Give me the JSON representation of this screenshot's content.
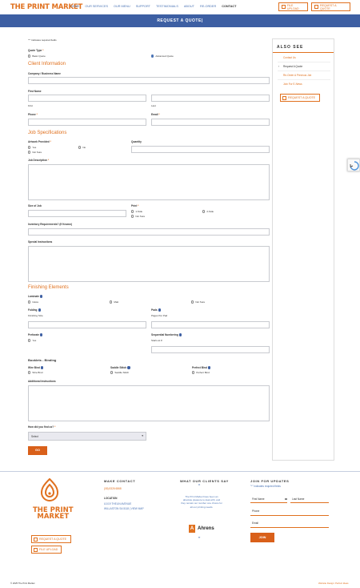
{
  "header": {
    "logo": "THE PRINT MARKET",
    "nav": [
      "HOME",
      "OUR SERVICES",
      "OUR MENU",
      "SUPPORT",
      "TESTIMONIALS",
      "ABOUT",
      "RE-ORDER",
      "CONTACT"
    ],
    "btn_upload": "FILE UPLOAD",
    "btn_quote": "REQUEST A QUOTE"
  },
  "banner": "REQUEST A QUOTE|",
  "form": {
    "required_note": "\"*\" indicates required fields",
    "quote_type_label": "Quote Type",
    "quote_type_options": [
      "Basic Quote",
      "Advanced Quote"
    ],
    "client_info_heading": "Client Information",
    "company_label": "Company / Business Name",
    "first_name_label": "First Name",
    "first_sub": "First",
    "last_sub": "Last",
    "phone_label": "Phone",
    "email_label": "Email",
    "job_spec_heading": "Job Specifications",
    "artwork_label": "Artwork Provided",
    "artwork_options": [
      "Yes",
      "No",
      "Not Sure"
    ],
    "quantity_label": "Quantity",
    "job_description_label": "Job Description",
    "size_label": "Size of Job",
    "print_label": "Print",
    "print_options": [
      "1-Side",
      "2-Side",
      "Not Sure"
    ],
    "inventory_label": "Inventory Requirements? (If Known)",
    "special_label": "Special Instructions",
    "finishing_heading": "Finishing Elements",
    "laminate_label": "Laminate",
    "laminate_options": [
      "Gloss",
      "Matt",
      "Not Sure"
    ],
    "folding_label": "Folding",
    "folding_sub": "Finishing Size",
    "pads_label": "Pads",
    "pads_sub": "Pages Per Pad",
    "perforate_label": "Perforate",
    "perforate_options": [
      "Yes"
    ],
    "numbering_label": "Sequential Numbering",
    "numbering_sub": "Starts at #",
    "booklets_heading": "Booklets - Binding",
    "wire_label": "Wire Bind",
    "wire_option": "Wire Bind",
    "saddle_label": "Saddle Stitch",
    "saddle_option": "Saddle Stitch",
    "perfect_label": "Perfect Bind",
    "perfect_option": "Perfect Bind",
    "additional_label": "Additional Instructions",
    "find_label": "How did you find us?",
    "find_select": "Select",
    "submit": "GO"
  },
  "sidebar": {
    "title": "ALSO SEE",
    "items": [
      "Contact Us",
      "Request A Quote",
      "Re-Order A Previous Job",
      "Join For E-News"
    ],
    "btn_quote": "REQUEST A QUOTE"
  },
  "footer": {
    "logo_line1": "THE PRINT",
    "logo_line2": "MARKET",
    "btn_quote": "REQUEST A QUOTE",
    "btn_upload": "FILE UPLOAD",
    "contact_heading": "MAKE CONTACT",
    "phone": "(08) 8326 6868",
    "location_label": "LOCATION",
    "address1": "U1/19 THELIN AVENUE",
    "address2": "WILLASTON SA 5118 | VIEW MAP",
    "clients_heading": "WHAT OUR CLIENTS SAY",
    "quote_open": "“",
    "quote_text": "The Print Market have been an absolute pleasure to deal with, and they remain our number one choice for all our printing needs.",
    "quote_close": "”",
    "client_logo": "Ahrens",
    "updates_heading": "JOIN FOR UPDATES",
    "updates_note": "\"*\" indicates required fields",
    "first_name": "First Name",
    "last_name": "Last Name",
    "phone_ph": "Phone",
    "email_ph": "Email",
    "join": "JOIN",
    "copyright": "© 2025 The Print Market",
    "credit": "Website Design: Perfect Ideas"
  },
  "colors": {
    "accent": "#e0711f",
    "brand_blue": "#3d5fa3",
    "link_blue": "#4b74b5"
  }
}
